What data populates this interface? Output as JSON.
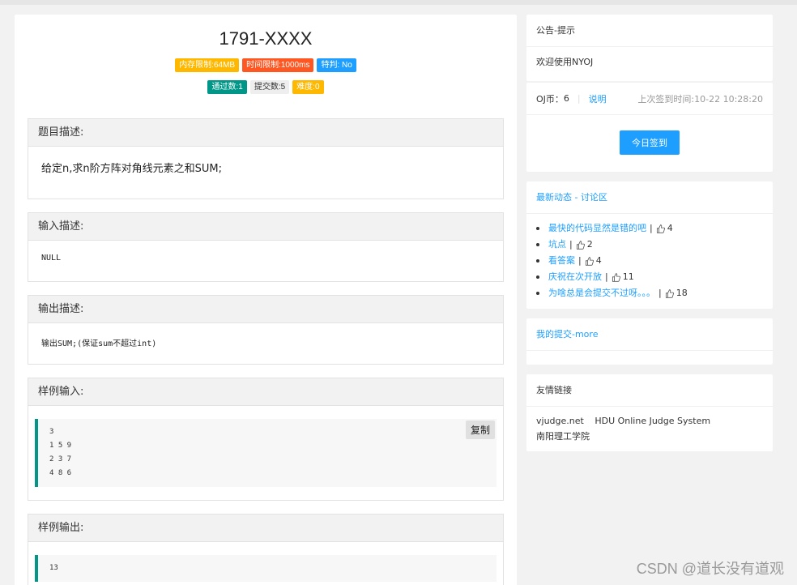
{
  "problem": {
    "title": "1791-XXXX",
    "badges_row1": [
      {
        "label": "内存限制:64MB",
        "color": "#FFB800"
      },
      {
        "label": "时间限制:1000ms",
        "color": "#FF5722"
      },
      {
        "label": "特判: No",
        "color": "#1E9FFF"
      }
    ],
    "badges_row2": [
      {
        "label": "通过数:1",
        "color": "#009688"
      },
      {
        "label": "提交数:5",
        "color": "#eeeeee"
      },
      {
        "label": "难度:0",
        "color": "#FFB800"
      }
    ],
    "description": {
      "heading": "题目描述:",
      "text": "给定n,求n阶方阵对角线元素之和SUM;"
    },
    "input": {
      "heading": "输入描述:",
      "text": "NULL"
    },
    "output": {
      "heading": "输出描述:",
      "text": "输出SUM;(保证sum不超过int)"
    },
    "sample_input": {
      "heading": "样例输入:",
      "copy_label": "复制",
      "lines": [
        "3",
        "1 5 9",
        "2 3 7",
        "4 8 6"
      ]
    },
    "sample_output": {
      "heading": "样例输出:",
      "lines": [
        "13"
      ]
    }
  },
  "sidebar": {
    "notice": {
      "heading": "公告-提示",
      "text": "欢迎使用NYOJ"
    },
    "coins": {
      "label": "OJ币：",
      "value": "6",
      "sep": "|",
      "help_link": "说明",
      "last_signin": "上次签到时间:10-22 10:28:20",
      "signin_button": "今日签到"
    },
    "discussion": {
      "heading": "最新动态 - 讨论区",
      "items": [
        {
          "title": "最快的代码显然是错的吧",
          "likes": "4"
        },
        {
          "title": "坑点",
          "likes": "2"
        },
        {
          "title": "看答案",
          "likes": "4"
        },
        {
          "title": "庆祝在次开放",
          "likes": "11"
        },
        {
          "title": "为啥总是会提交不过呀。。。",
          "likes": "18"
        }
      ]
    },
    "submissions": {
      "heading": "我的提交-more"
    },
    "friend_links": {
      "heading": "友情链接",
      "links": [
        "vjudge.net",
        "HDU Online Judge System",
        "南阳理工学院"
      ]
    }
  },
  "watermark": "CSDN @道长没有道观"
}
